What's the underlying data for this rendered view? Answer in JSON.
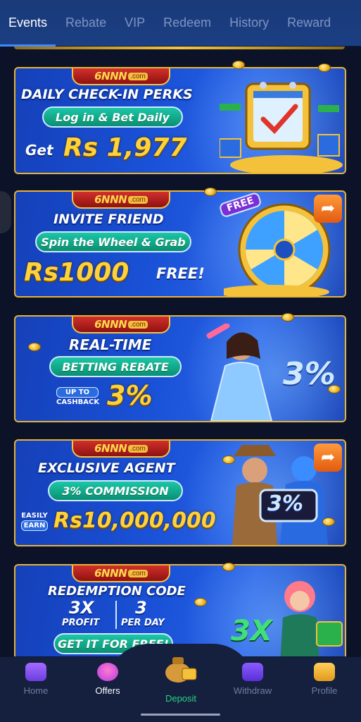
{
  "tabs": [
    {
      "label": "Events",
      "active": true
    },
    {
      "label": "Rebate"
    },
    {
      "label": "VIP"
    },
    {
      "label": "Redeem"
    },
    {
      "label": "History"
    },
    {
      "label": "Reward"
    }
  ],
  "brand": {
    "name": "6NNN",
    "suffix": ".com"
  },
  "banners": {
    "checkin": {
      "title": "DAILY CHECK-IN PERKS",
      "pill": "Log in & Bet Daily",
      "get": "Get",
      "amount": "Rs 1,977"
    },
    "invite": {
      "title": "INVITE FRIEND",
      "pill": "Spin the Wheel & Grab",
      "amount": "Rs1000",
      "free_text": "FREE!",
      "free_tag": "FREE"
    },
    "rebate": {
      "title": "REAL-TIME",
      "pill": "BETTING REBATE",
      "upto": "UP TO",
      "cashback": "CASHBACK",
      "percent": "3%",
      "art_percent": "3%"
    },
    "agent": {
      "title": "EXCLUSIVE AGENT",
      "pill": "3% COMMISSION",
      "easily": "EASILY",
      "earn": "EARN",
      "amount": "Rs10,000,000",
      "art_percent": "3%"
    },
    "redeem": {
      "title": "REDEMPTION CODE",
      "x3": "3X",
      "profit": "PROFIT",
      "three": "3",
      "perday": "PER DAY",
      "pill": "GET IT FOR FREE!",
      "art_text": "3X"
    }
  },
  "nav": {
    "home": "Home",
    "offers": "Offers",
    "deposit": "Deposit",
    "withdraw": "Withdraw",
    "profile": "Profile"
  },
  "colors": {
    "accent": "#3f8bff",
    "gold": "#ffd23a",
    "deposit_green": "#2bd07f",
    "nav_bg": "#15203f"
  }
}
